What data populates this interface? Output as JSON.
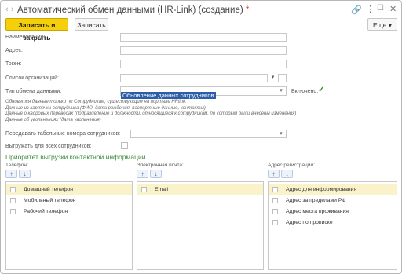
{
  "window": {
    "title": "Автоматический обмен данными (HR-Link) (создание)",
    "modified_mark": "*"
  },
  "icons": [
    "back-icon",
    "forward-icon",
    "star-icon",
    "link-icon",
    "menu-icon",
    "maximize-icon",
    "close-icon"
  ],
  "toolbar": {
    "save_close_label": "Записать и закрыть",
    "save_label": "Записать",
    "more_label": "Еще",
    "more_arrow": "▾"
  },
  "form": {
    "name_label": "Наименование:",
    "address_label": "Адрес:",
    "token_label": "Токен:",
    "orgs_label": "Список организаций:",
    "orgs_dots": "...",
    "exchange_type_label": "Тип обмена данными:",
    "exchange_type_value": "Обновление данных сотрудников",
    "enabled_label": "Включено:",
    "enabled_checked": true
  },
  "info_lines": [
    "Обновятся данные только по Сотрудникам, существующим на портале HRlink:",
    "Данные из карточки сотрудника (ФИО, дата рождения, паспортные данные, контакты)",
    "Данные о кадровых переводах (подразделение и должности, относящиеся к сотрудникам, по которым были внесены изменения)",
    "Данные об увольнениях (дата увольнения)"
  ],
  "options": {
    "tabnum_label": "Передавать табельные номера сотрудников:",
    "all_employees_label": "Выгружать для всех сотрудников:",
    "all_employees_checked": false
  },
  "priority": {
    "title": "Приоритет выгрузки контактной информации",
    "columns": [
      {
        "header": "Телефон:",
        "items": [
          "Домашний телефон",
          "Мобильный телефон",
          "Рабочий телефон"
        ]
      },
      {
        "header": "Электронная почта:",
        "items": [
          "Email"
        ]
      },
      {
        "header": "Адрес регистрации:",
        "items": [
          "Адрес для информирования",
          "Адрес за пределами РФ",
          "Адрес места проживания",
          "Адрес по прописке"
        ]
      }
    ]
  },
  "colors": {
    "accent_yellow": "#f5d00a",
    "section_green": "#3a8a3a",
    "selection_blue": "#2b5da8",
    "row_highlight": "#faf2c8"
  }
}
